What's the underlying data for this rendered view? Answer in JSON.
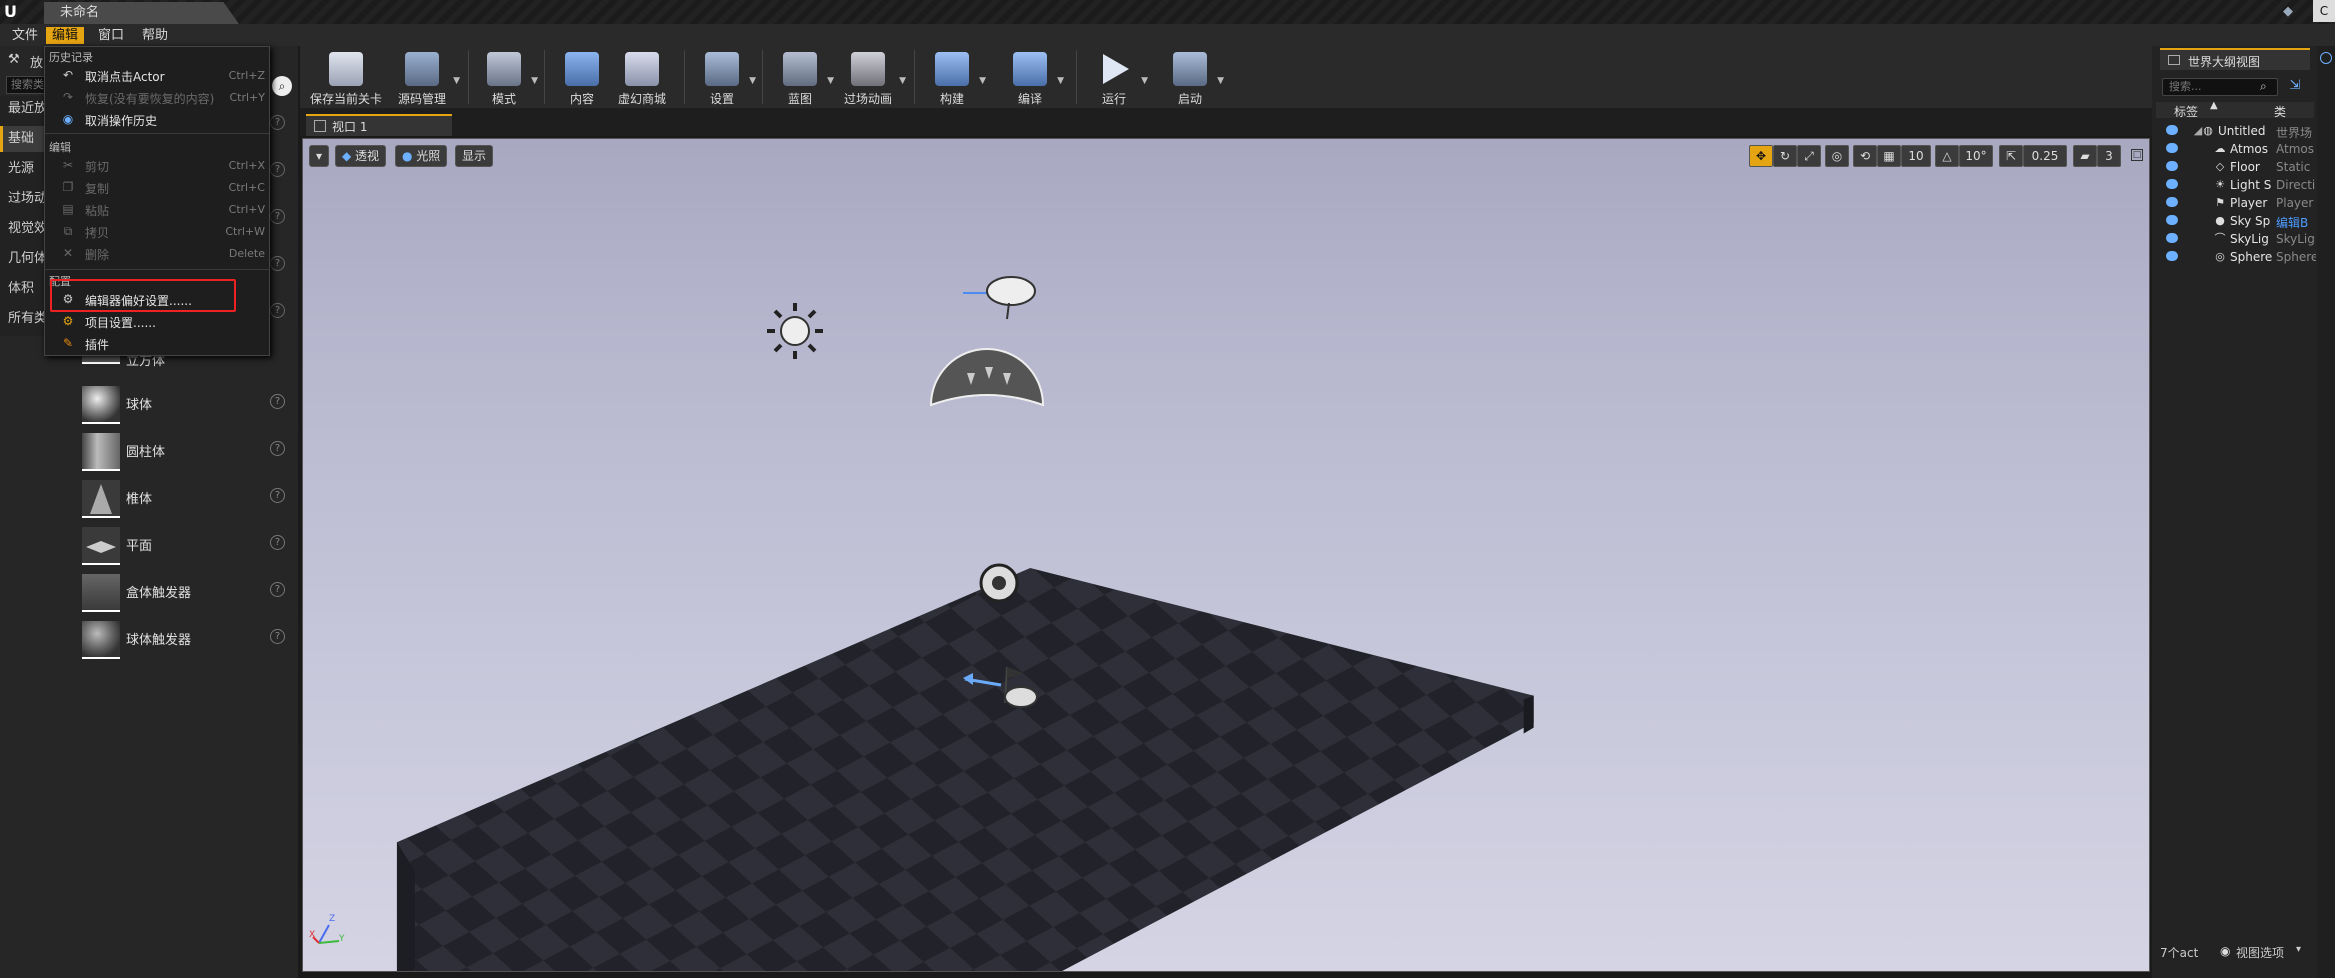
{
  "titlebar": {
    "doc_tab": "未命名",
    "corner_letter": "C"
  },
  "menubar": {
    "items": [
      "文件",
      "编辑",
      "窗口",
      "帮助"
    ],
    "active": "编辑"
  },
  "left_panel": {
    "search_placeholder": "搜索类",
    "header_stub": "放",
    "categories": [
      "最近放",
      "基础",
      "光源",
      "过场动",
      "视觉效",
      "几何体",
      "体积",
      "所有类"
    ],
    "selected_category": "基础",
    "place_items": [
      "立方体",
      "球体",
      "圆柱体",
      "椎体",
      "平面",
      "盒体触发器",
      "球体触发器"
    ]
  },
  "dropdown": {
    "sections": {
      "history": "历史记录",
      "edit": "编辑",
      "config": "配置"
    },
    "history_items": [
      {
        "label": "取消点击Actor",
        "shortcut": "Ctrl+Z",
        "disabled": false,
        "icon": "undo-icon"
      },
      {
        "label": "恢复(没有要恢复的内容)",
        "shortcut": "Ctrl+Y",
        "disabled": true,
        "icon": "redo-icon"
      },
      {
        "label": "取消操作历史",
        "shortcut": "",
        "disabled": false,
        "icon": "history-icon"
      }
    ],
    "edit_items": [
      {
        "label": "剪切",
        "shortcut": "Ctrl+X",
        "disabled": true
      },
      {
        "label": "复制",
        "shortcut": "Ctrl+C",
        "disabled": true
      },
      {
        "label": "粘贴",
        "shortcut": "Ctrl+V",
        "disabled": true
      },
      {
        "label": "拷贝",
        "shortcut": "Ctrl+W",
        "disabled": true
      },
      {
        "label": "删除",
        "shortcut": "Delete",
        "disabled": true
      }
    ],
    "config_items": [
      {
        "label": "编辑器偏好设置......",
        "highlighted": true
      },
      {
        "label": "项目设置......"
      },
      {
        "label": "插件"
      }
    ]
  },
  "toolbar": {
    "buttons": [
      {
        "label": "保存当前关卡",
        "icon": "save-icon",
        "color": "#c8ccd8"
      },
      {
        "label": "源码管理",
        "icon": "source-control-icon",
        "color": "#9ab0d0"
      },
      {
        "label": "模式",
        "icon": "modes-icon",
        "color": "#b0b8c8"
      },
      {
        "label": "内容",
        "icon": "content-icon",
        "color": "#7aa6e0"
      },
      {
        "label": "虚幻商城",
        "icon": "marketplace-icon",
        "color": "#c0c8e0"
      },
      {
        "label": "设置",
        "icon": "settings-icon",
        "color": "#9ab0d0"
      },
      {
        "label": "蓝图",
        "icon": "blueprint-icon",
        "color": "#9aa8c0"
      },
      {
        "label": "过场动画",
        "icon": "cinematics-icon",
        "color": "#c0c0c8"
      },
      {
        "label": "构建",
        "icon": "build-icon",
        "color": "#7aa6e0"
      },
      {
        "label": "编译",
        "icon": "compile-icon",
        "color": "#7aa6e0"
      },
      {
        "label": "运行",
        "icon": "play-icon",
        "color": "#cfd6e6"
      },
      {
        "label": "启动",
        "icon": "launch-icon",
        "color": "#9ab0d0"
      }
    ]
  },
  "viewport": {
    "tab_label": "视口 1",
    "view_mode_buttons": [
      "透视",
      "光照",
      "显示"
    ],
    "grid_snap": "10",
    "rotation_snap": "10°",
    "scale_snap": "0.25",
    "camera_speed": "3"
  },
  "outliner": {
    "title": "世界大纲视图",
    "search_placeholder": "搜索...",
    "col_label": "标签",
    "col_type": "类",
    "rows": [
      {
        "name": "Untitled",
        "type": "世界场"
      },
      {
        "name": "Atmos",
        "type": "Atmos"
      },
      {
        "name": "Floor",
        "type": "Static"
      },
      {
        "name": "Light S",
        "type": "Directi"
      },
      {
        "name": "Player",
        "type": "Player"
      },
      {
        "name": "Sky Sp",
        "type": "编辑B"
      },
      {
        "name": "SkyLig",
        "type": "SkyLig"
      },
      {
        "name": "Sphere",
        "type": "Sphere"
      }
    ],
    "actor_count": "7个act",
    "view_options": "视图选项"
  },
  "colors": {
    "accent": "#e5a411",
    "highlight_box": "#e22222",
    "link": "#4d9bff"
  }
}
